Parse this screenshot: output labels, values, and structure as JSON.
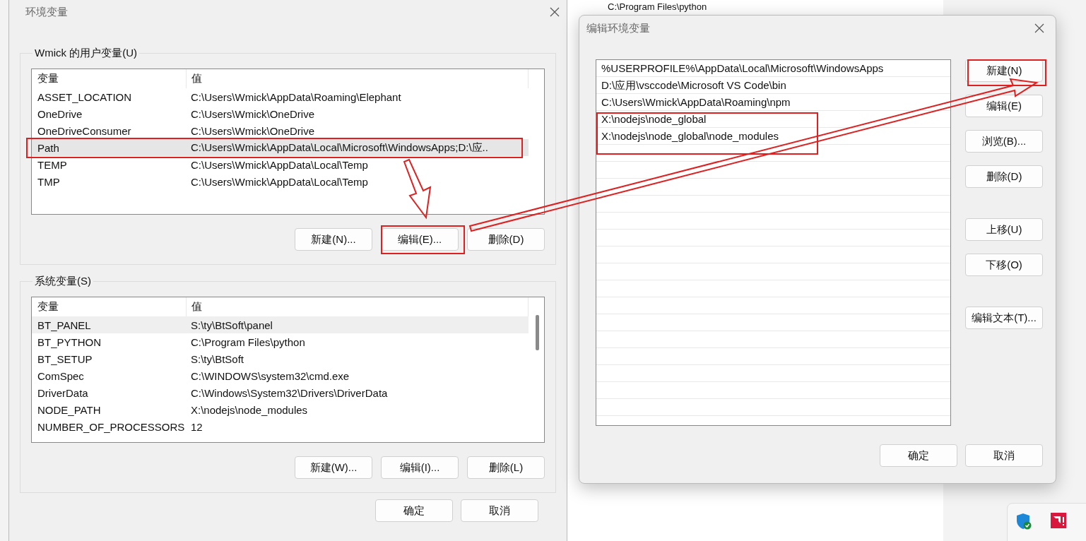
{
  "background_window": {
    "text": "C:\\Program Files\\python"
  },
  "env_dialog": {
    "title": "环境变量",
    "user_group": {
      "label": "Wmick 的用户变量(U)",
      "columns": [
        "变量",
        "值"
      ],
      "rows": [
        {
          "name": "ASSET_LOCATION",
          "value": "C:\\Users\\Wmick\\AppData\\Roaming\\Elephant",
          "selected": false
        },
        {
          "name": "OneDrive",
          "value": "C:\\Users\\Wmick\\OneDrive",
          "selected": false
        },
        {
          "name": "OneDriveConsumer",
          "value": "C:\\Users\\Wmick\\OneDrive",
          "selected": false
        },
        {
          "name": "Path",
          "value": "C:\\Users\\Wmick\\AppData\\Local\\Microsoft\\WindowsApps;D:\\应..",
          "selected": true
        },
        {
          "name": "TEMP",
          "value": "C:\\Users\\Wmick\\AppData\\Local\\Temp",
          "selected": false
        },
        {
          "name": "TMP",
          "value": "C:\\Users\\Wmick\\AppData\\Local\\Temp",
          "selected": false
        }
      ],
      "buttons": [
        "新建(N)...",
        "编辑(E)...",
        "删除(D)"
      ]
    },
    "system_group": {
      "label": "系统变量(S)",
      "columns": [
        "变量",
        "值"
      ],
      "rows": [
        {
          "name": "BT_PANEL",
          "value": "S:\\ty\\BtSoft\\panel",
          "selected": true
        },
        {
          "name": "BT_PYTHON",
          "value": "C:\\Program Files\\python",
          "selected": false
        },
        {
          "name": "BT_SETUP",
          "value": "S:\\ty\\BtSoft",
          "selected": false
        },
        {
          "name": "ComSpec",
          "value": "C:\\WINDOWS\\system32\\cmd.exe",
          "selected": false
        },
        {
          "name": "DriverData",
          "value": "C:\\Windows\\System32\\Drivers\\DriverData",
          "selected": false
        },
        {
          "name": "NODE_PATH",
          "value": "X:\\nodejs\\node_modules",
          "selected": false
        },
        {
          "name": "NUMBER_OF_PROCESSORS",
          "value": "12",
          "selected": false
        }
      ],
      "buttons": [
        "新建(W)...",
        "编辑(I)...",
        "删除(L)"
      ]
    },
    "buttons": [
      "确定",
      "取消"
    ]
  },
  "edit_dialog": {
    "title": "编辑环境变量",
    "entries": [
      "%USERPROFILE%\\AppData\\Local\\Microsoft\\WindowsApps",
      "D:\\应用\\vsccode\\Microsoft VS Code\\bin",
      "C:\\Users\\Wmick\\AppData\\Roaming\\npm",
      "X:\\nodejs\\node_global",
      "X:\\nodejs\\node_global\\node_modules"
    ],
    "side_button_groups": [
      [
        "新建(N)",
        "编辑(E)",
        "浏览(B)...",
        "删除(D)"
      ],
      [
        "上移(U)",
        "下移(O)"
      ],
      [
        "编辑文本(T)..."
      ]
    ],
    "buttons": [
      "确定",
      "取消"
    ]
  }
}
